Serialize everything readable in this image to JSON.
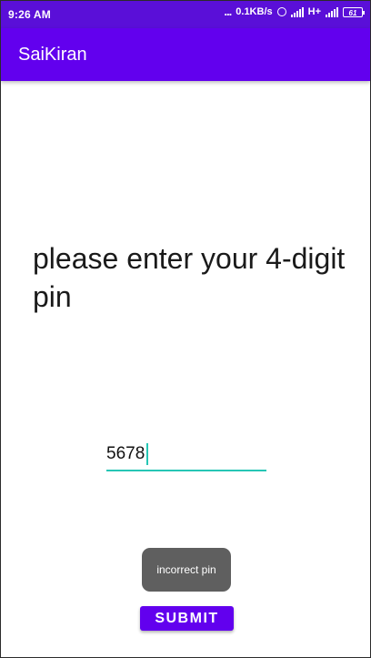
{
  "status_bar": {
    "time": "9:26 AM",
    "more_indicator": "...",
    "network_speed": "0.1KB/s",
    "network_type": "H+",
    "battery_level": "61",
    "icons": [
      "alarm-icon",
      "signal-icon",
      "signal-icon",
      "battery-icon"
    ]
  },
  "app_bar": {
    "title": "SaiKiran",
    "color": "#6200ee"
  },
  "main": {
    "prompt": "please enter your 4-digit pin",
    "pin_value": "5678",
    "accent_color": "#26c6b5"
  },
  "toast": {
    "message": "incorrect pin"
  },
  "submit_button": {
    "label": "SUBMIT"
  }
}
